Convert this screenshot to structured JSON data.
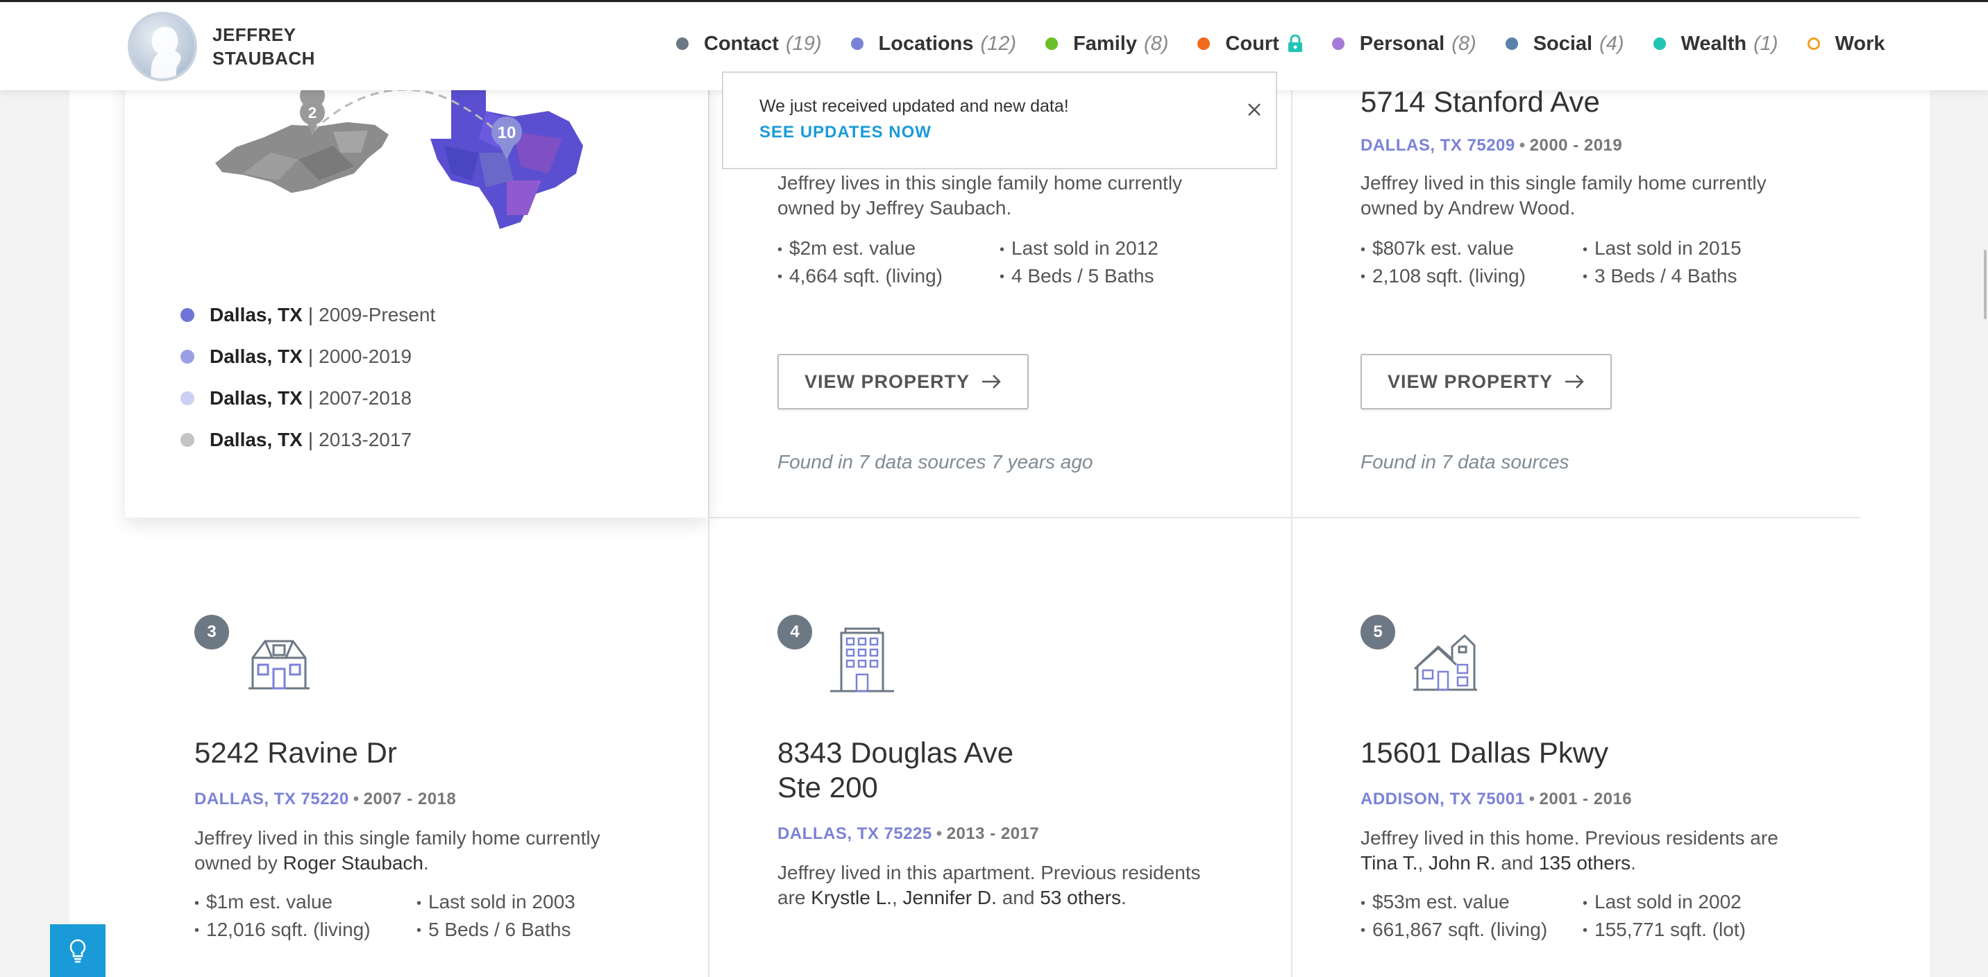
{
  "brand": {
    "first": "JEFFREY",
    "last": "STAUBACH"
  },
  "nav": [
    {
      "label": "Contact",
      "count": "(19)",
      "color": "#6d7885"
    },
    {
      "label": "Locations",
      "count": "(12)",
      "color": "#7a82d8"
    },
    {
      "label": "Family",
      "count": "(8)",
      "color": "#6abf2a"
    },
    {
      "label": "Court",
      "count": "",
      "color": "#f26a1b",
      "locked": true
    },
    {
      "label": "Personal",
      "count": "(8)",
      "color": "#a57ad9"
    },
    {
      "label": "Social",
      "count": "(4)",
      "color": "#5a82aa"
    },
    {
      "label": "Wealth",
      "count": "(1)",
      "color": "#22c4b5"
    },
    {
      "label": "Work",
      "count": "",
      "color": "#f0a01e"
    }
  ],
  "notice": {
    "text": "We just received updated and new data!",
    "link": "SEE UPDATES NOW"
  },
  "map": {
    "pin_nc": "2",
    "pin_tx": "10"
  },
  "locations": [
    {
      "city": "Dallas, TX",
      "years": "2009-Present",
      "color": "#6f75d6"
    },
    {
      "city": "Dallas, TX",
      "years": "2000-2019",
      "color": "#9a9fe3"
    },
    {
      "city": "Dallas, TX",
      "years": "2007-2018",
      "color": "#cdd0f2"
    },
    {
      "city": "Dallas, TX",
      "years": "2013-2017",
      "color": "#c4c4c4"
    }
  ],
  "properties": {
    "p1": {
      "desc_a": "Jeffrey lives in this single family home currently",
      "desc_b": "owned by Jeffrey Saubach.",
      "f1": "$2m est. value",
      "f2": "Last sold in 2012",
      "f3": "4,664 sqft. (living)",
      "f4": "4 Beds / 5 Baths",
      "button": "VIEW PROPERTY",
      "found": "Found in 7 data sources 7 years ago"
    },
    "p2": {
      "address": "5714 Stanford Ave",
      "city": "DALLAS, TX 75209",
      "years": "2000 - 2019",
      "desc_a": "Jeffrey lived in this single family home currently",
      "desc_b": "owned by Andrew Wood.",
      "f1": "$807k est. value",
      "f2": "Last sold in 2015",
      "f3": "2,108 sqft. (living)",
      "f4": "3 Beds / 4 Baths",
      "button": "VIEW PROPERTY",
      "found": "Found in 7 data sources"
    },
    "p3": {
      "num": "3",
      "address": "5242 Ravine Dr",
      "city": "DALLAS, TX 75220",
      "years": "2007 - 2018",
      "desc_a": "Jeffrey lived in this single family home currently",
      "desc_b_pre": "owned by ",
      "desc_b_name": "Roger Staubach",
      "desc_b_post": ".",
      "f1": "$1m est. value",
      "f2": "Last sold in 2003",
      "f3": "12,016 sqft. (living)",
      "f4": "5 Beds / 6 Baths"
    },
    "p4": {
      "num": "4",
      "address_1": "8343 Douglas Ave",
      "address_2": "Ste 200",
      "city": "DALLAS, TX 75225",
      "years": "2013 - 2017",
      "desc_a": "Jeffrey lived in this apartment. Previous residents",
      "desc_b_pre": "are ",
      "n1": "Krystle L.",
      "comma": ", ",
      "n2": "Jennifer D.",
      "and": " and ",
      "n3": "53 others",
      "end": "."
    },
    "p5": {
      "num": "5",
      "address": "15601 Dallas Pkwy",
      "city": "ADDISON, TX 75001",
      "years": "2001 - 2016",
      "desc_a": "Jeffrey lived in this home. Previous residents are",
      "n1": "Tina T.",
      "comma": ", ",
      "n2": "John R.",
      "and": " and ",
      "n3": "135 others",
      "end": ".",
      "f1": "$53m est. value",
      "f2": "Last sold in 2002",
      "f3": "661,867 sqft. (living)",
      "f4": "155,771 sqft. (lot)"
    }
  },
  "colors": {
    "accent_link": "#1a9bd7",
    "city_text": "#7a82d8",
    "badge": "#6d7885",
    "icon_stroke": "#6d7885"
  }
}
